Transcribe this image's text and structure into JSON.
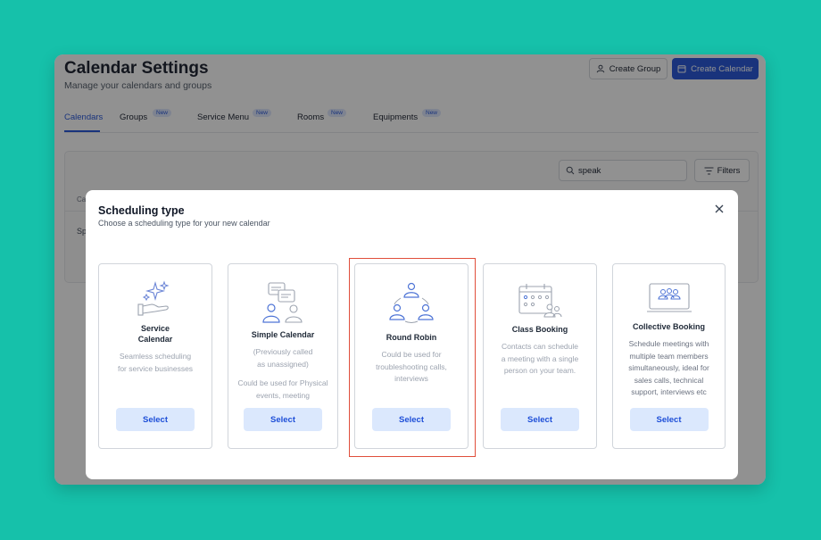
{
  "colors": {
    "background": "#16c1aa",
    "accent": "#1e4fd8",
    "select_bg": "#dbe8fd",
    "highlight": "#e04e3b"
  },
  "header": {
    "title": "Calendar Settings",
    "subtitle": "Manage your calendars and groups",
    "create_group_label": "Create Group",
    "create_calendar_label": "Create Calendar"
  },
  "tabs": [
    {
      "label": "Calendars",
      "badge": ""
    },
    {
      "label": "Groups",
      "badge": "New"
    },
    {
      "label": "Service Menu",
      "badge": "New"
    },
    {
      "label": "Rooms",
      "badge": "New"
    },
    {
      "label": "Equipments",
      "badge": "New"
    }
  ],
  "toolbar": {
    "search_value": "speak",
    "filters_label": "Filters"
  },
  "table": {
    "header_partial": "Ca",
    "row_partial": "Sp"
  },
  "modal": {
    "title": "Scheduling type",
    "subtitle": "Choose a scheduling type for your new calendar",
    "cards": [
      {
        "icon": "sparkle-hand-icon",
        "title_line1": "Service",
        "title_line2": "Calendar",
        "desc_line1": "Seamless scheduling",
        "desc_line2": "for service businesses",
        "button": "Select"
      },
      {
        "icon": "chat-people-icon",
        "title_line1": "Simple Calendar",
        "desc_line1": "(Previously called",
        "desc_line2": "as unassigned)",
        "desc_line3": "Could be used for Physical",
        "desc_line4": "events, meeting",
        "button": "Select"
      },
      {
        "icon": "round-robin-icon",
        "title_line1": "Round Robin",
        "desc_line1": "Could be used for",
        "desc_line2": "troubleshooting calls,",
        "desc_line3": "interviews",
        "button": "Select"
      },
      {
        "icon": "class-calendar-icon",
        "title_line1": "Class Booking",
        "desc_line1": "Contacts can schedule",
        "desc_line2": "a meeting with a single",
        "desc_line3": "person on your team.",
        "button": "Select"
      },
      {
        "icon": "group-screen-icon",
        "title_line1": "Collective Booking",
        "desc_line1": "Schedule meetings with",
        "desc_line2": "multiple team members",
        "desc_line3": "simultaneously, ideal for",
        "desc_line4": "sales calls, technical",
        "desc_line5": "support, interviews etc",
        "button": "Select"
      }
    ]
  }
}
